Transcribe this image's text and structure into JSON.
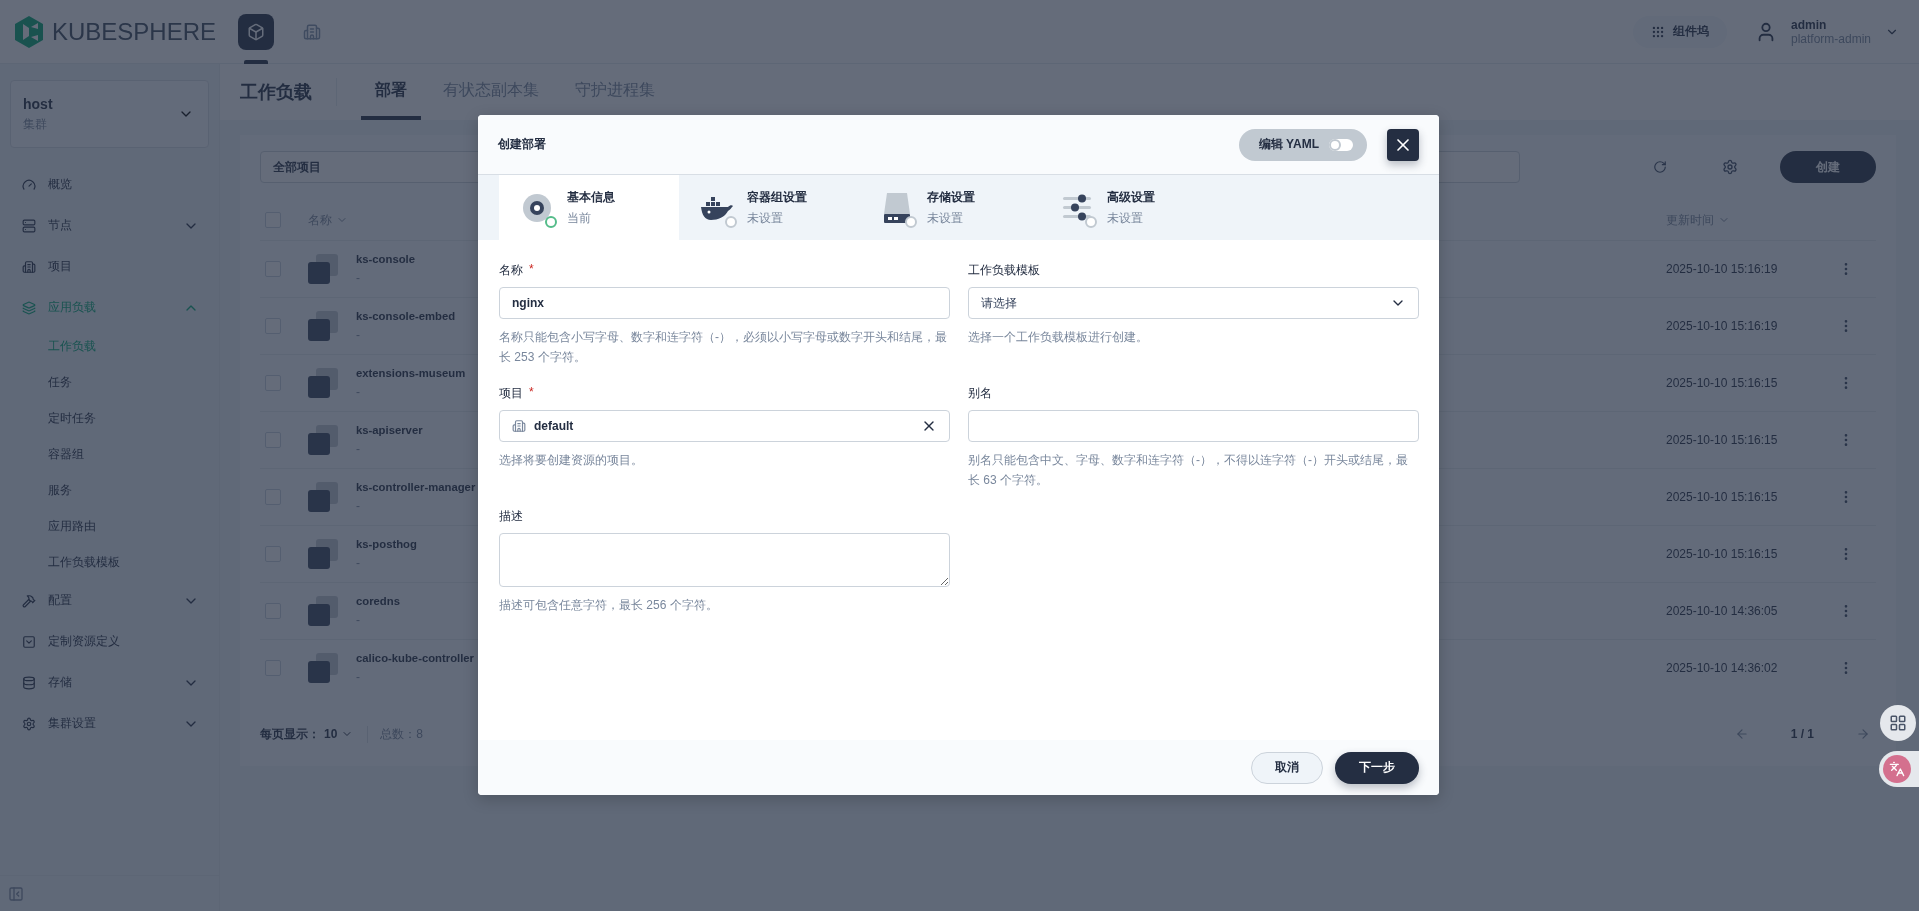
{
  "topbar": {
    "logo": "KUBESPHERE",
    "nav": [
      {
        "kind": "cube",
        "selected": true
      },
      {
        "kind": "building",
        "selected": false
      }
    ],
    "dock": "组件坞",
    "user": {
      "name": "admin",
      "role": "platform-admin"
    }
  },
  "sidebar": {
    "cluster": {
      "name": "host",
      "type": "集群"
    },
    "items": [
      {
        "label": "概览",
        "kind": "gauge",
        "selected": false
      },
      {
        "label": "节点",
        "kind": "server",
        "selected": false,
        "expanded": false
      },
      {
        "label": "项目",
        "kind": "building",
        "selected": false
      },
      {
        "label": "应用负载",
        "kind": "layers",
        "selected": true,
        "expanded": true,
        "children": [
          {
            "label": "工作负载",
            "selected": true
          },
          {
            "label": "任务",
            "selected": false
          },
          {
            "label": "定时任务",
            "selected": false
          },
          {
            "label": "容器组",
            "selected": false
          },
          {
            "label": "服务",
            "selected": false
          },
          {
            "label": "应用路由",
            "selected": false
          },
          {
            "label": "工作负载模板",
            "selected": false
          }
        ]
      },
      {
        "label": "配置",
        "kind": "hammer",
        "selected": false,
        "expanded": false
      },
      {
        "label": "定制资源定义",
        "kind": "crd",
        "selected": false
      },
      {
        "label": "存储",
        "kind": "database",
        "selected": false,
        "expanded": false
      },
      {
        "label": "集群设置",
        "kind": "gear",
        "selected": false,
        "expanded": false
      }
    ]
  },
  "page": {
    "title": "工作负载",
    "tabs": [
      {
        "label": "部署",
        "selected": true
      },
      {
        "label": "有状态副本集",
        "selected": false
      },
      {
        "label": "守护进程集",
        "selected": false
      }
    ]
  },
  "toolbar": {
    "project_select": "全部项目",
    "create": "创建"
  },
  "table": {
    "columns": [
      "名称",
      "更新时间"
    ],
    "select_all_checked": false,
    "rows": [
      {
        "name": "ks-console",
        "description": "-",
        "updated": "2025-10-10 15:16:19",
        "checked": false
      },
      {
        "name": "ks-console-embed",
        "description": "-",
        "updated": "2025-10-10 15:16:19",
        "checked": false
      },
      {
        "name": "extensions-museum",
        "description": "-",
        "updated": "2025-10-10 15:16:15",
        "checked": false
      },
      {
        "name": "ks-apiserver",
        "description": "-",
        "updated": "2025-10-10 15:16:15",
        "checked": false
      },
      {
        "name": "ks-controller-manager",
        "description": "-",
        "updated": "2025-10-10 15:16:15",
        "checked": false
      },
      {
        "name": "ks-posthog",
        "description": "-",
        "updated": "2025-10-10 15:16:15",
        "checked": false
      },
      {
        "name": "coredns",
        "description": "-",
        "updated": "2025-10-10 14:36:05",
        "checked": false
      },
      {
        "name": "calico-kube-controller",
        "description": "-",
        "updated": "2025-10-10 14:36:02",
        "checked": false
      }
    ]
  },
  "pagination": {
    "per_page_label": "每页显示：",
    "per_page": "10",
    "total": "总数：8",
    "page": "1 / 1"
  },
  "modal": {
    "title": "创建部署",
    "yaml_toggle": {
      "label": "编辑 YAML",
      "on": false
    },
    "steps": [
      {
        "kind": "info",
        "title": "基本信息",
        "status": "当前",
        "selected": true
      },
      {
        "kind": "container",
        "title": "容器组设置",
        "status": "未设置",
        "selected": false
      },
      {
        "kind": "storage",
        "title": "存储设置",
        "status": "未设置",
        "selected": false
      },
      {
        "kind": "advanced",
        "title": "高级设置",
        "status": "未设置",
        "selected": false
      }
    ],
    "fields": [
      {
        "kind": "text",
        "label": "名称",
        "required_mark": "*",
        "value": "nginx",
        "hint": "名称只能包含小写字母、数字和连字符（-），必须以小写字母或数字开头和结尾，最长 253 个字符。"
      },
      {
        "kind": "select",
        "label": "工作负载模板",
        "placeholder": "请选择",
        "hint": "选择一个工作负载模板进行创建。"
      },
      {
        "kind": "project",
        "label": "项目",
        "required_mark": "*",
        "value": "default",
        "hint": "选择将要创建资源的项目。"
      },
      {
        "kind": "text",
        "label": "别名",
        "hint": "别名只能包含中文、字母、数字和连字符（-），不得以连字符（-）开头或结尾，最长 63 个字符。"
      },
      {
        "kind": "textarea",
        "label": "描述",
        "hint": "描述可包含任意字符，最长 256 个字符。"
      }
    ],
    "buttons": {
      "cancel": "取消",
      "next": "下一步"
    }
  }
}
